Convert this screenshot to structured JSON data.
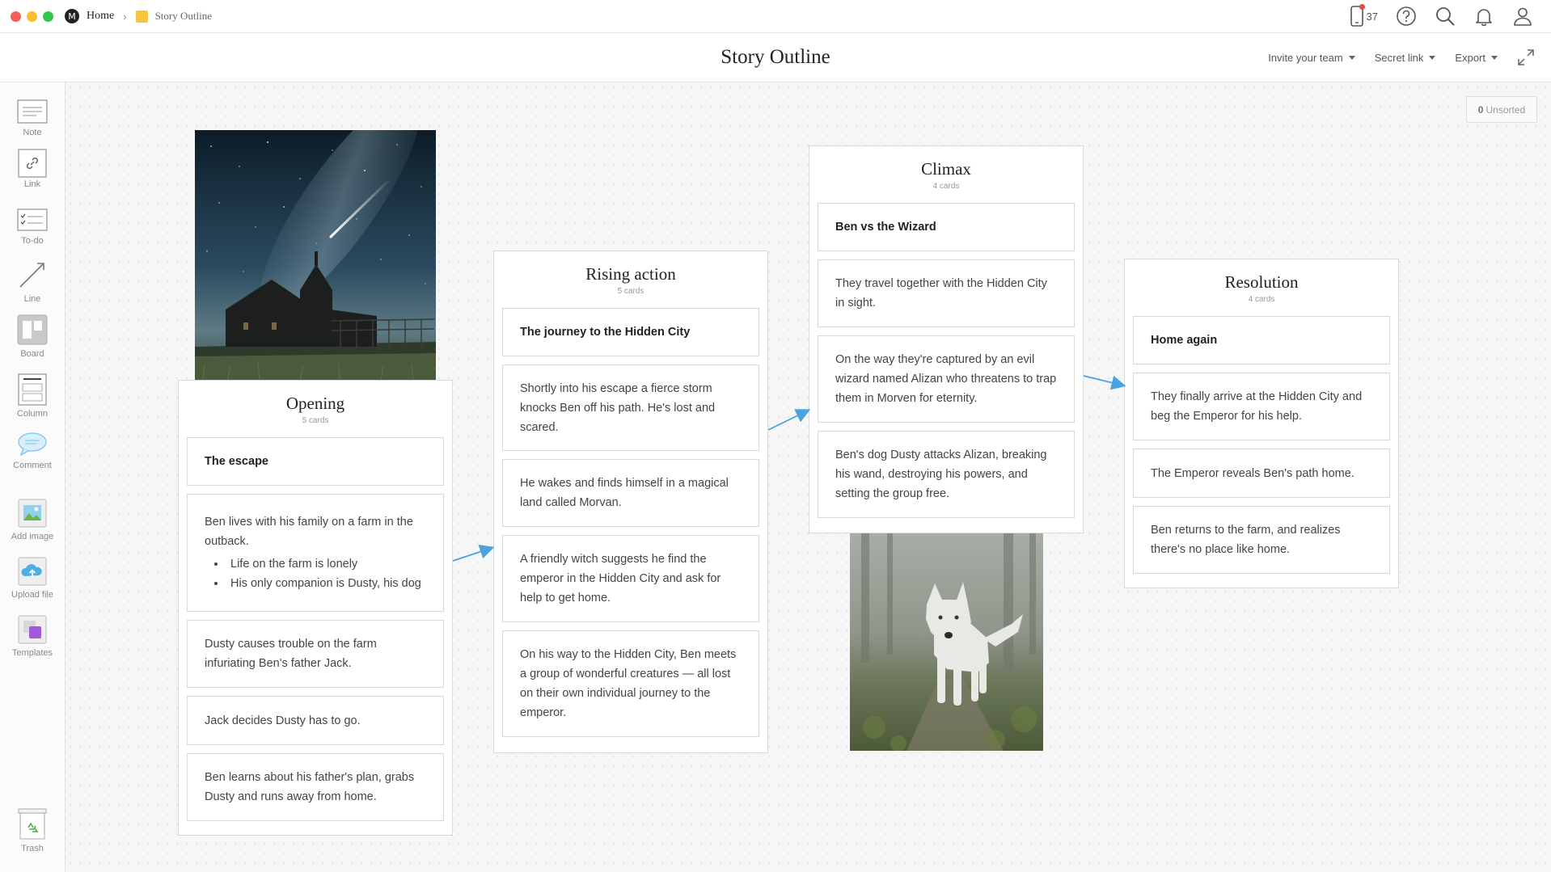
{
  "window": {
    "traffic_colors": [
      "#fc5b57",
      "#fdbc2f",
      "#33c748"
    ]
  },
  "breadcrumb": {
    "logo_glyph": "M",
    "home": "Home",
    "separator": "›",
    "board": "Story Outline"
  },
  "top_icons": {
    "device_count": "37",
    "icons": [
      "device-icon",
      "help-icon",
      "search-icon",
      "bell-icon",
      "user-icon"
    ]
  },
  "header": {
    "title": "Story Outline",
    "actions": [
      "Invite your team",
      "Secret link",
      "Export"
    ]
  },
  "sidebar": {
    "tools": [
      {
        "label": "Note",
        "icon": "note-icon"
      },
      {
        "label": "Link",
        "icon": "link-icon"
      },
      {
        "label": "To-do",
        "icon": "todo-icon"
      },
      {
        "label": "Line",
        "icon": "line-icon"
      },
      {
        "label": "Board",
        "icon": "board-icon"
      },
      {
        "label": "Column",
        "icon": "column-icon"
      },
      {
        "label": "Comment",
        "icon": "comment-icon"
      },
      {
        "label": "Add image",
        "icon": "image-icon"
      },
      {
        "label": "Upload file",
        "icon": "upload-icon"
      },
      {
        "label": "Templates",
        "icon": "templates-icon"
      }
    ],
    "trash": {
      "label": "Trash",
      "icon": "trash-icon"
    }
  },
  "unsorted": {
    "count": "0",
    "label": "Unsorted"
  },
  "columns": [
    {
      "title": "Opening",
      "count": "5 cards",
      "cards": [
        {
          "text": "The escape",
          "bold": true
        },
        {
          "text": "Ben lives with his family on a farm in the outback.",
          "bullets": [
            "Life on the farm is lonely",
            "His only companion is Dusty, his dog"
          ]
        },
        {
          "text": "Dusty causes trouble on the farm infuriating Ben's father Jack."
        },
        {
          "text": "Jack decides Dusty has to go."
        },
        {
          "text": "Ben learns about his father's plan, grabs Dusty and runs away from home."
        }
      ]
    },
    {
      "title": "Rising action",
      "count": "5 cards",
      "cards": [
        {
          "text": "The journey to the Hidden City",
          "bold": true
        },
        {
          "text": "Shortly into his escape a fierce storm knocks Ben off his path. He's lost and scared."
        },
        {
          "text": "He wakes and finds himself in a magical land called Morvan."
        },
        {
          "text": "A friendly witch suggests he find the emperor in the Hidden City and ask for help to get home."
        },
        {
          "text": "On his way to the Hidden City, Ben meets a group of wonderful creatures — all lost on their own individual journey to the emperor."
        }
      ]
    },
    {
      "title": "Climax",
      "count": "4 cards",
      "cards": [
        {
          "text": "Ben vs the Wizard",
          "bold": true
        },
        {
          "text": "They travel together with the Hidden City in sight."
        },
        {
          "text": "On the way they're captured by an evil wizard named Alizan who threatens to trap them in Morven for eternity."
        },
        {
          "text": "Ben's dog Dusty attacks Alizan, breaking his wand, destroying his powers, and setting the group free."
        }
      ]
    },
    {
      "title": "Resolution",
      "count": "4 cards",
      "cards": [
        {
          "text": "Home again",
          "bold": true
        },
        {
          "text": "They finally arrive at the Hidden City and beg the Emperor for his help."
        },
        {
          "text": "The Emperor reveals Ben's path home."
        },
        {
          "text": "Ben returns to the farm, and realizes there's no place like home."
        }
      ]
    }
  ],
  "images": [
    {
      "name": "night-sky-church-image"
    },
    {
      "name": "white-wolf-image"
    }
  ],
  "colors": {
    "arrow": "#4aa3df",
    "accent": "#f6c440"
  }
}
